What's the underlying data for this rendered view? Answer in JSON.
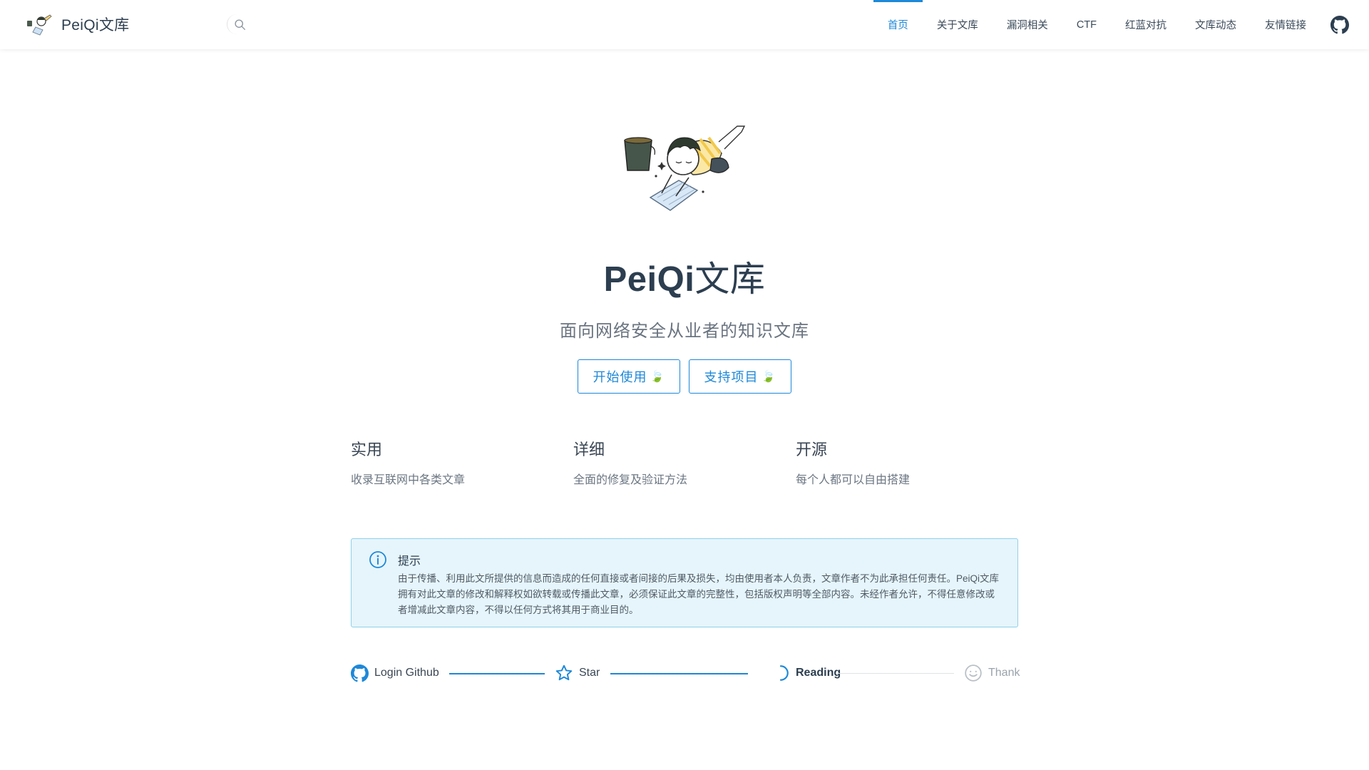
{
  "brand": {
    "title": "PeiQi文库"
  },
  "nav": {
    "items": [
      {
        "label": "首页",
        "active": true
      },
      {
        "label": "关于文库",
        "active": false
      },
      {
        "label": "漏洞相关",
        "active": false
      },
      {
        "label": "CTF",
        "active": false
      },
      {
        "label": "红蓝对抗",
        "active": false
      },
      {
        "label": "文库动态",
        "active": false
      },
      {
        "label": "友情链接",
        "active": false
      }
    ]
  },
  "hero": {
    "title_latin": "PeiQi",
    "title_cn": "文库",
    "description": "面向网络安全从业者的知识文库",
    "actions": [
      {
        "label": "开始使用",
        "emoji": "🍃"
      },
      {
        "label": "支持项目",
        "emoji": "🍃"
      }
    ]
  },
  "features": [
    {
      "title": "实用",
      "details": "收录互联网中各类文章"
    },
    {
      "title": "详细",
      "details": "全面的修复及验证方法"
    },
    {
      "title": "开源",
      "details": "每个人都可以自由搭建"
    }
  ],
  "alert": {
    "title": "提示",
    "text": "由于传播、利用此文所提供的信息而造成的任何直接或者间接的后果及损失，均由使用者本人负责，文章作者不为此承担任何责任。PeiQi文库 拥有对此文章的修改和解释权如欲转载或传播此文章，必须保证此文章的完整性，包括版权声明等全部内容。未经作者允许，不得任意修改或者增减此文章内容，不得以任何方式将其用于商业目的。"
  },
  "steps": [
    {
      "label": "Login Github",
      "state": "done",
      "icon": "github-icon"
    },
    {
      "label": "Star",
      "state": "done",
      "icon": "star-icon"
    },
    {
      "label": "Reading",
      "state": "current",
      "icon": "loading-icon"
    },
    {
      "label": "Thank",
      "state": "pending",
      "icon": "smile-icon"
    }
  ],
  "colors": {
    "accent": "#1e88d8",
    "alert_bg": "#e6f5fb",
    "alert_border": "#8fd0ea"
  }
}
